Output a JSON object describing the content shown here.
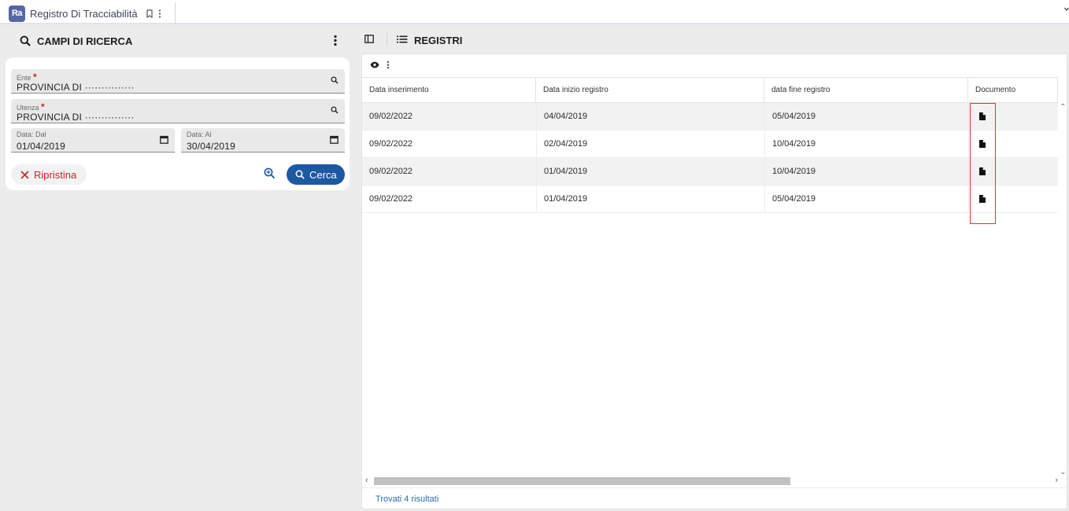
{
  "tab": {
    "logo_text": "Ra",
    "title": "Registro Di Tracciabilità"
  },
  "search_panel": {
    "title": "CAMPI DI RICERCA",
    "fields": {
      "ente": {
        "label": "Ente",
        "value": "PROVINCIA DI ···············"
      },
      "utenza": {
        "label": "Utenza",
        "value": "PROVINCIA DI ···············"
      },
      "data_dal": {
        "label": "Data: Dal",
        "value": "01/04/2019"
      },
      "data_al": {
        "label": "Data: Al",
        "value": "30/04/2019"
      }
    },
    "required_marker": "*",
    "reset_label": "Ripristina",
    "search_label": "Cerca"
  },
  "results_panel": {
    "title": "REGISTRI",
    "columns": [
      "Data inserimento",
      "Data inizio registro",
      "data fine registro",
      "Documento"
    ],
    "rows": [
      {
        "data_inserimento": "09/02/2022",
        "data_inizio": "04/04/2019",
        "data_fine": "05/04/2019"
      },
      {
        "data_inserimento": "09/02/2022",
        "data_inizio": "02/04/2019",
        "data_fine": "10/04/2019"
      },
      {
        "data_inserimento": "09/02/2022",
        "data_inizio": "01/04/2019",
        "data_fine": "10/04/2019"
      },
      {
        "data_inserimento": "09/02/2022",
        "data_inizio": "01/04/2019",
        "data_fine": "05/04/2019"
      }
    ],
    "footer_text": "Trovati 4 risultati"
  },
  "colors": {
    "primary": "#1d58a2",
    "danger": "#c0262c",
    "link": "#2c6fa8",
    "logo": "#5667a8",
    "highlight": "#d23a3a"
  },
  "icons": {
    "tab": [
      "app-logo-icon",
      "bookmark-icon",
      "more-vert-icon",
      "chevron-down-icon"
    ],
    "search_panel": [
      "search-icon",
      "more-vert-icon",
      "calendar-icon",
      "close-icon",
      "zoom-in-icon"
    ],
    "results_panel": [
      "sidebar-toggle-icon",
      "list-icon",
      "eye-icon",
      "more-vert-icon",
      "document-icon"
    ]
  }
}
